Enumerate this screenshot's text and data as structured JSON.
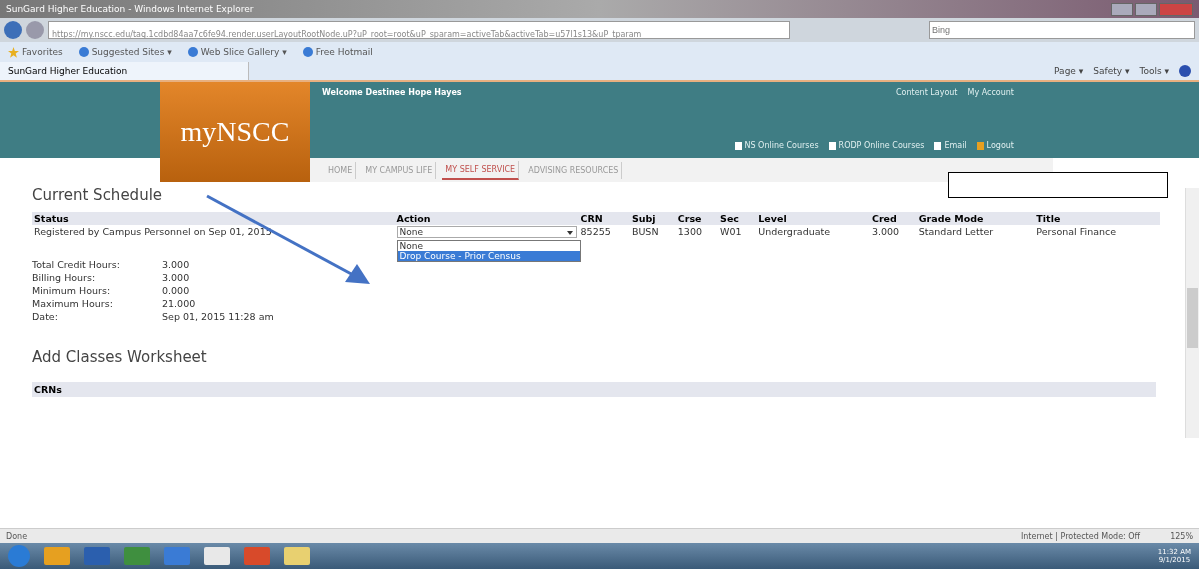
{
  "window": {
    "title": "SunGard Higher Education - Windows Internet Explorer"
  },
  "browser": {
    "address": "https://my.nscc.edu/tag.1cdbd84aa7c6fe94.render.userLayoutRootNode.uP?uP_root=root&uP_sparam=activeTab&activeTab=u57l1s13&uP_tparam",
    "search_placeholder": "Bing",
    "favorites": [
      {
        "label": "Favorites",
        "kind": "star"
      },
      {
        "label": "Suggested Sites ▾",
        "kind": "site"
      },
      {
        "label": "Web Slice Gallery ▾",
        "kind": "site"
      },
      {
        "label": "Free Hotmail",
        "kind": "site"
      }
    ],
    "tab": "SunGard Higher Education",
    "commands": [
      "Page ▾",
      "Safety ▾",
      "Tools ▾"
    ]
  },
  "portal": {
    "logo": "myNSCC",
    "welcome": "Welcome Destinee Hope Hayes",
    "top_links": [
      "Content Layout",
      "My Account"
    ],
    "links": [
      {
        "label": "NS Online Courses",
        "kind": "doc"
      },
      {
        "label": "RODP Online Courses",
        "kind": "doc"
      },
      {
        "label": "Email",
        "kind": "doc"
      },
      {
        "label": "Logout",
        "kind": "exit"
      }
    ],
    "nav": [
      {
        "label": "HOME",
        "selected": false
      },
      {
        "label": "MY CAMPUS LIFE",
        "selected": false
      },
      {
        "label": "MY SELF SERVICE",
        "selected": true
      },
      {
        "label": "ADVISING RESOURCES",
        "selected": false
      }
    ]
  },
  "schedule": {
    "heading": "Current Schedule",
    "columns": [
      "Status",
      "Action",
      "CRN",
      "Subj",
      "Crse",
      "Sec",
      "Level",
      "Cred",
      "Grade Mode",
      "Title"
    ],
    "rows": [
      {
        "status": "Registered by Campus Personnel on Sep 01, 2015",
        "action": "None",
        "crn": "85255",
        "subj": "BUSN",
        "crse": "1300",
        "sec": "W01",
        "level": "Undergraduate",
        "cred": "3.000",
        "grade_mode": "Standard Letter",
        "title": "Personal Finance",
        "options": [
          {
            "label": "None",
            "selected": false
          },
          {
            "label": "Drop Course - Prior Census",
            "selected": true
          }
        ]
      }
    ],
    "summary": [
      {
        "label": "Total Credit Hours:",
        "value": "3.000"
      },
      {
        "label": "Billing Hours:",
        "value": "3.000"
      },
      {
        "label": "Minimum Hours:",
        "value": "0.000"
      },
      {
        "label": "Maximum Hours:",
        "value": "21.000"
      },
      {
        "label": "Date:",
        "value": "Sep 01, 2015 11:28 am"
      }
    ]
  },
  "worksheet": {
    "heading": "Add Classes Worksheet",
    "columns": [
      "CRNs"
    ]
  },
  "status_bar": {
    "text": "Done",
    "zone": "Internet | Protected Mode: Off",
    "zoom": "125%"
  },
  "taskbar": {
    "time": "11:32 AM",
    "date": "9/1/2015"
  }
}
